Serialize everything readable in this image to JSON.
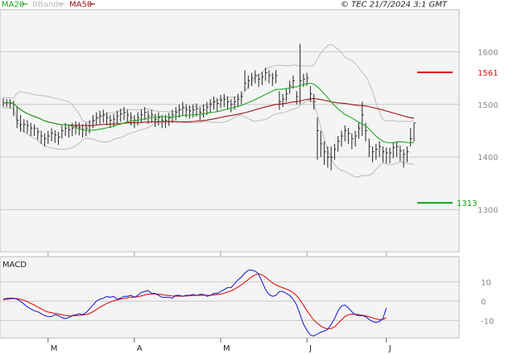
{
  "header": {
    "legend": [
      {
        "label": "MA20",
        "color": "#1aa81a"
      },
      {
        "label": "BBands",
        "color": "#bbbbbb"
      },
      {
        "label": "MA50",
        "color": "#a01010"
      }
    ],
    "copyright": "© TEC 21/7/2024 3:1 GMT"
  },
  "colors": {
    "panel": "#f4f4f4",
    "grid": "#c8c8c8",
    "candle": "#222222",
    "ma20": "#1aa81a",
    "ma50": "#a01010",
    "bbands": "#bbbbbb",
    "resistance": "#e01010",
    "support": "#10a010",
    "macd": "#2222cc",
    "signal": "#dd1111"
  },
  "chart_data": [
    {
      "type": "candlestick",
      "title": "",
      "ylim": [
        1220,
        1680
      ],
      "y_ticks": [
        1300,
        1400,
        1500,
        1600
      ],
      "y_tick_labels": [
        "1300",
        "1400",
        "1500",
        "1600"
      ],
      "grid": true,
      "x_month_labels": [
        "M",
        "A",
        "M",
        "J",
        "J"
      ],
      "resistance": {
        "value": 1561,
        "label": "1561"
      },
      "support": {
        "value": 1313,
        "label": "1313"
      },
      "close": [
        1503,
        1503,
        1502,
        1500,
        1470,
        1462,
        1462,
        1460,
        1455,
        1455,
        1448,
        1440,
        1435,
        1440,
        1445,
        1442,
        1438,
        1450,
        1455,
        1452,
        1455,
        1458,
        1456,
        1452,
        1455,
        1460,
        1470,
        1475,
        1478,
        1480,
        1475,
        1470,
        1472,
        1478,
        1482,
        1485,
        1480,
        1475,
        1470,
        1475,
        1480,
        1485,
        1478,
        1480,
        1472,
        1475,
        1470,
        1470,
        1474,
        1480,
        1485,
        1490,
        1495,
        1490,
        1488,
        1490,
        1492,
        1485,
        1490,
        1495,
        1500,
        1505,
        1502,
        1508,
        1510,
        1505,
        1500,
        1505,
        1510,
        1515,
        1540,
        1545,
        1550,
        1555,
        1548,
        1552,
        1560,
        1555,
        1550,
        1555,
        1505,
        1510,
        1520,
        1535,
        1545,
        1515,
        1545,
        1548,
        1550,
        1520,
        1505,
        1450,
        1425,
        1410,
        1400,
        1400,
        1415,
        1430,
        1440,
        1450,
        1445,
        1435,
        1440,
        1455,
        1480,
        1450,
        1420,
        1410,
        1415,
        1420,
        1410,
        1408,
        1408,
        1418,
        1420,
        1412,
        1405,
        1410,
        1435,
        1465
      ],
      "high": [
        1512,
        1510,
        1510,
        1507,
        1495,
        1480,
        1472,
        1470,
        1465,
        1462,
        1456,
        1450,
        1445,
        1450,
        1455,
        1451,
        1448,
        1460,
        1465,
        1462,
        1465,
        1468,
        1466,
        1462,
        1465,
        1470,
        1480,
        1485,
        1488,
        1490,
        1485,
        1480,
        1482,
        1488,
        1492,
        1495,
        1490,
        1485,
        1480,
        1485,
        1490,
        1495,
        1488,
        1490,
        1482,
        1485,
        1480,
        1480,
        1484,
        1490,
        1495,
        1500,
        1505,
        1500,
        1498,
        1500,
        1502,
        1495,
        1500,
        1505,
        1510,
        1515,
        1512,
        1518,
        1520,
        1515,
        1510,
        1515,
        1520,
        1525,
        1565,
        1555,
        1560,
        1565,
        1558,
        1562,
        1570,
        1565,
        1560,
        1565,
        1525,
        1520,
        1530,
        1545,
        1555,
        1525,
        1615,
        1558,
        1560,
        1535,
        1520,
        1475,
        1450,
        1430,
        1420,
        1420,
        1425,
        1440,
        1450,
        1460,
        1455,
        1445,
        1450,
        1465,
        1505,
        1465,
        1435,
        1420,
        1425,
        1430,
        1420,
        1418,
        1418,
        1428,
        1430,
        1422,
        1415,
        1420,
        1455,
        1465
      ],
      "low": [
        1495,
        1495,
        1493,
        1478,
        1455,
        1448,
        1447,
        1445,
        1440,
        1440,
        1433,
        1425,
        1420,
        1425,
        1430,
        1427,
        1423,
        1435,
        1440,
        1437,
        1440,
        1443,
        1441,
        1437,
        1440,
        1445,
        1455,
        1460,
        1463,
        1465,
        1460,
        1455,
        1457,
        1463,
        1467,
        1470,
        1465,
        1460,
        1455,
        1460,
        1465,
        1470,
        1463,
        1465,
        1457,
        1460,
        1455,
        1455,
        1459,
        1465,
        1470,
        1475,
        1480,
        1475,
        1473,
        1475,
        1477,
        1470,
        1475,
        1480,
        1485,
        1490,
        1487,
        1493,
        1495,
        1490,
        1485,
        1490,
        1495,
        1500,
        1525,
        1530,
        1535,
        1540,
        1533,
        1537,
        1545,
        1540,
        1535,
        1540,
        1490,
        1495,
        1505,
        1520,
        1530,
        1500,
        1500,
        1533,
        1535,
        1505,
        1490,
        1395,
        1400,
        1385,
        1380,
        1375,
        1395,
        1410,
        1420,
        1430,
        1425,
        1415,
        1420,
        1435,
        1440,
        1430,
        1400,
        1390,
        1395,
        1400,
        1390,
        1388,
        1388,
        1398,
        1400,
        1392,
        1380,
        1390,
        1420,
        1430
      ]
    },
    {
      "type": "line",
      "title": "MACD",
      "ylim": [
        -19,
        23
      ],
      "y_ticks": [
        10,
        0,
        -10
      ],
      "y_tick_labels": [
        "10",
        "0",
        "-10"
      ],
      "grid": true,
      "series": [
        {
          "values": [
            1.0,
            1.4,
            1.5,
            1.5,
            1.0,
            0.0,
            -1.5,
            -3.0,
            -4.0,
            -5.0,
            -5.5,
            -6.5,
            -7.5,
            -8.0,
            -8.0,
            -7.0,
            -7.5,
            -8.5,
            -9.0,
            -8.5,
            -7.5,
            -7.0,
            -6.5,
            -7.0,
            -6.0,
            -4.0,
            -2.0,
            0.0,
            1.0,
            1.5,
            2.5,
            2.0,
            2.5,
            1.0,
            1.5,
            2.5,
            2.5,
            3.0,
            2.0,
            3.0,
            4.5,
            5.0,
            5.5,
            4.0,
            4.0,
            3.0,
            2.0,
            2.0,
            2.0,
            1.5,
            3.0,
            3.0,
            2.5,
            3.0,
            3.0,
            3.5,
            3.0,
            3.5,
            3.5,
            2.5,
            3.0,
            4.0,
            4.0,
            5.0,
            6.0,
            7.0,
            7.0,
            9.0,
            11.0,
            12.5,
            14.5,
            16.0,
            16.0,
            15.5,
            14.0,
            10.0,
            6.0,
            3.5,
            2.5,
            3.0,
            5.0,
            5.0,
            4.0,
            3.0,
            1.0,
            -2.0,
            -7.0,
            -12.0,
            -15.0,
            -17.5,
            -18.0,
            -17.0,
            -16.0,
            -15.5,
            -14.5,
            -12.0,
            -9.0,
            -5.0,
            -2.5,
            -2.0,
            -3.5,
            -5.5,
            -7.0,
            -7.5,
            -7.5,
            -8.0,
            -9.5,
            -10.5,
            -11.0,
            -10.5,
            -9.0,
            -3.5
          ]
        },
        {
          "values": [
            0.8,
            1.0,
            1.2,
            1.3,
            1.3,
            1.0,
            0.5,
            -0.3,
            -1.2,
            -2.0,
            -3.0,
            -4.0,
            -5.0,
            -5.6,
            -6.0,
            -6.3,
            -6.6,
            -7.0,
            -7.4,
            -7.6,
            -7.6,
            -7.5,
            -7.3,
            -7.2,
            -7.0,
            -6.4,
            -5.5,
            -4.3,
            -3.2,
            -2.2,
            -1.2,
            -0.5,
            0.2,
            0.6,
            1.0,
            1.4,
            1.7,
            2.0,
            2.1,
            2.3,
            2.7,
            3.2,
            3.6,
            3.7,
            3.7,
            3.6,
            3.4,
            3.1,
            2.9,
            2.7,
            2.6,
            2.6,
            2.6,
            2.7,
            2.8,
            2.9,
            3.0,
            3.0,
            3.1,
            3.0,
            3.0,
            3.2,
            3.4,
            3.7,
            4.1,
            4.7,
            5.3,
            6.2,
            7.3,
            8.4,
            9.8,
            11.2,
            12.6,
            13.6,
            14.1,
            13.6,
            12.4,
            10.9,
            9.5,
            8.4,
            7.6,
            6.9,
            6.3,
            5.5,
            4.4,
            2.8,
            0.6,
            -2.2,
            -5.0,
            -7.5,
            -9.8,
            -11.5,
            -12.8,
            -13.8,
            -14.3,
            -14.2,
            -13.2,
            -11.5,
            -9.6,
            -8.0,
            -7.0,
            -6.7,
            -6.8,
            -7.0,
            -7.3,
            -7.6,
            -8.1,
            -8.6,
            -9.2,
            -9.5,
            -9.4,
            -8.6
          ]
        }
      ]
    }
  ]
}
